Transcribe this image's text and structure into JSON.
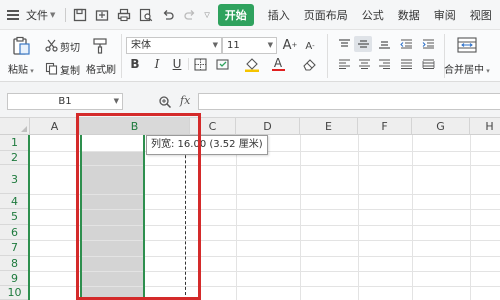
{
  "menubar": {
    "file_label": "文件",
    "start_tab": "开始",
    "tabs": [
      "插入",
      "页面布局",
      "公式",
      "数据",
      "审阅",
      "视图"
    ],
    "quick_access": [
      "save-icon",
      "export-icon",
      "print-icon",
      "print-preview-icon",
      "undo-icon",
      "redo-icon"
    ],
    "accent_color": "#2fa25e"
  },
  "ribbon": {
    "paste_label": "粘贴",
    "cut_label": "剪切",
    "copy_label": "复制",
    "format_painter_label": "格式刷",
    "font_name": "宋体",
    "font_size": "11",
    "bold": "B",
    "italic": "I",
    "underline": "U",
    "font_color_letter": "A",
    "grow_font": "A",
    "shrink_font": "A",
    "merge_center_label": "合并居中"
  },
  "formula_bar": {
    "name_box": "B1",
    "fx_label": "fx",
    "formula": ""
  },
  "grid": {
    "columns": [
      "A",
      "B",
      "C",
      "D",
      "E",
      "F",
      "G",
      "H"
    ],
    "rows": [
      "1",
      "2",
      "3",
      "4",
      "5",
      "6",
      "7",
      "8",
      "9",
      "10"
    ],
    "selected_column": "B",
    "active_cell": "B1",
    "tooltip": "列宽: 16.00 (3.52 厘米)",
    "selection_color": "#2e8f4e",
    "highlight_color": "#d42a2a"
  }
}
